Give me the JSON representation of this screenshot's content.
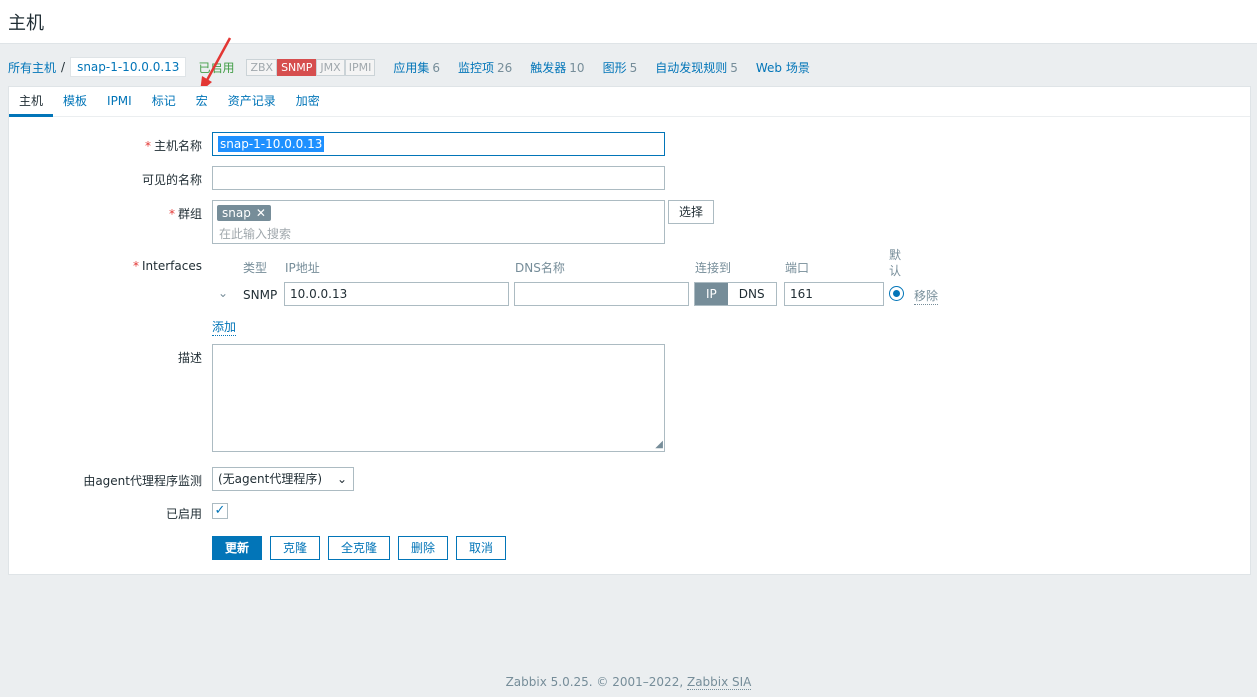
{
  "header": {
    "title": "主机"
  },
  "breadcrumb": {
    "all_hosts": "所有主机",
    "sep": "/",
    "current_host": "snap-1-10.0.0.13",
    "status": "已启用",
    "availability": [
      "ZBX",
      "SNMP",
      "JMX",
      "IPMI"
    ],
    "availability_active": "SNMP",
    "links": [
      {
        "label": "应用集",
        "count": "6"
      },
      {
        "label": "监控项",
        "count": "26"
      },
      {
        "label": "触发器",
        "count": "10"
      },
      {
        "label": "图形",
        "count": "5"
      },
      {
        "label": "自动发现规则",
        "count": "5"
      },
      {
        "label": "Web 场景",
        "count": ""
      }
    ]
  },
  "tabs": [
    "主机",
    "模板",
    "IPMI",
    "标记",
    "宏",
    "资产记录",
    "加密"
  ],
  "form": {
    "host_name_label": "主机名称",
    "host_name_value": "snap-1-10.0.0.13",
    "visible_name_label": "可见的名称",
    "visible_name_value": "",
    "groups_label": "群组",
    "group_tag": "snap",
    "group_placeholder": "在此输入搜索",
    "select_button": "选择",
    "interfaces_label": "Interfaces",
    "if_headers": {
      "type": "类型",
      "ip": "IP地址",
      "dns": "DNS名称",
      "connect": "连接到",
      "port": "端口",
      "default": "默认"
    },
    "if_row": {
      "type": "SNMP",
      "ip": "10.0.0.13",
      "dns": "",
      "connect_ip": "IP",
      "connect_dns": "DNS",
      "port": "161",
      "remove": "移除"
    },
    "add_link": "添加",
    "description_label": "描述",
    "proxy_label": "由agent代理程序监测",
    "proxy_value": "(无agent代理程序)",
    "enabled_label": "已启用",
    "buttons": {
      "update": "更新",
      "clone": "克隆",
      "full_clone": "全克隆",
      "delete": "删除",
      "cancel": "取消"
    }
  },
  "footer": {
    "text": "Zabbix 5.0.25. © 2001–2022,",
    "link": "Zabbix SIA"
  },
  "colors": {
    "accent": "#0275b8",
    "enabled": "#429e47",
    "snmp_bad": "#d64e4e",
    "arrow": "#e33734"
  }
}
